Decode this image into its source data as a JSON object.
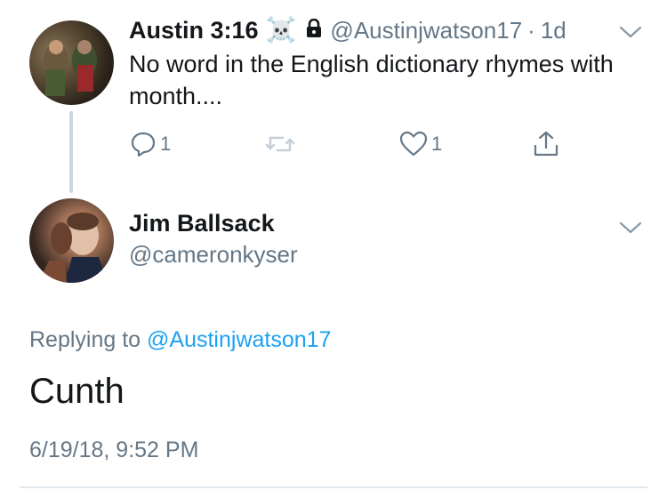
{
  "tweet": {
    "author_name": "Austin 3:16",
    "emoji": "☠️",
    "protected_icon": "lock-icon",
    "handle": "@Austinjwatson17",
    "separator": "·",
    "age": "1d",
    "text": "No word in the English dictionary rhymes with month....",
    "actions": {
      "reply_count": "1",
      "retweet_count": "",
      "like_count": "1"
    }
  },
  "reply": {
    "author_name": "Jim Ballsack",
    "handle": "@cameronkyser",
    "replying_label": "Replying to",
    "replying_handle": "@Austinjwatson17",
    "text": "Cunth",
    "timestamp": "6/19/18, 9:52 PM"
  },
  "colors": {
    "accent": "#1da1f2",
    "secondary_text": "#657786",
    "icon_gray": "#657786",
    "thread_line": "#ccd6dd"
  }
}
